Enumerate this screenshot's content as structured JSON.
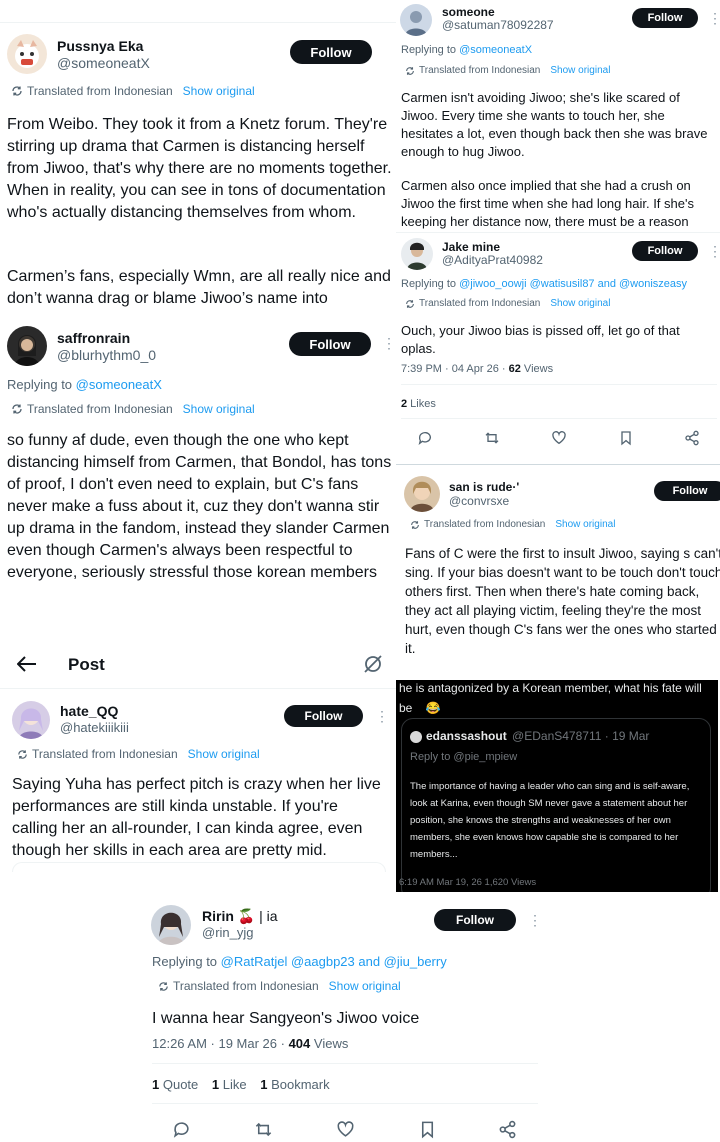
{
  "panel1": {
    "author": "Pussnya Eka",
    "handle": "@someoneatX",
    "follow": "Follow",
    "translated": "Translated from Indonesian",
    "show_original": "Show original",
    "text_p1": "From Weibo. They took it from a Knetz forum. They're stirring up drama that Carmen is distancing herself from Jiwoo, that's why there are no moments together. When in reality, you can see in tons of documentation who's actually distancing themselves from whom.",
    "text_p2": "Carmen’s fans, especially Wmn, are all really nice and don’t wanna drag or blame Jiwoo’s name into"
  },
  "panel2": {
    "author": "saffronrain",
    "handle": "@blurhythm0_0",
    "follow": "Follow",
    "replying_prefix": "Replying to",
    "replying_to": "@someoneatX",
    "translated": "Translated from Indonesian",
    "show_original": "Show original",
    "text": "so funny af dude, even though the one who kept distancing himself from Carmen, that Bondol, has tons of proof, I don't even need to explain, but C's fans never make a fuss about it, cuz they don't wanna stir up drama in the fandom, instead they slander Carmen even though Carmen's always been respectful to everyone, seriously stressful those korean members"
  },
  "panel3": {
    "author": "someone",
    "handle": "@satuman78092287",
    "follow": "Follow",
    "replying_prefix": "Replying to",
    "replying_to": "@someoneatX",
    "translated": "Translated from Indonesian",
    "show_original": "Show original",
    "text_p1": "Carmen isn't avoiding Jiwoo; she's like scared of Jiwoo. Every time she wants to touch her, she hesitates a lot, even though back then she was brave enough to hug Jiwoo.",
    "text_p2": "Carmen also once implied that she had a crush on Jiwoo the first time when she had long hair. If she's keeping her distance now, there must be a reason"
  },
  "panel4": {
    "author": "Jake mine",
    "handle": "@AdityaPrat40982",
    "follow": "Follow",
    "replying_prefix": "Replying to",
    "replying_to": "@jiwoo_oowji @watisusil87 and @woniszeasy",
    "translated": "Translated from Indonesian",
    "show_original": "Show original",
    "text": "Ouch, your Jiwoo bias is pissed off, let go of that oplas.",
    "time": "7:39 PM · 04 Apr 26 · ",
    "views_count": "62",
    "views_label": " Views",
    "likes_count": "2",
    "likes_label": " Likes"
  },
  "panel5": {
    "author": "san is rude",
    "author_suffix": "·'",
    "handle": "@convrsxe",
    "follow": "Follow",
    "translated": "Translated from Indonesian",
    "show_original": "Show original",
    "text": "Fans of C were the first to insult Jiwoo, saying s can't sing. If your bias doesn't want to be touch don't touch others first. Then when there's hate coming back, they act all playing victim, feeling they're the most hurt, even though C's fans wer the ones who started it."
  },
  "panel6": {
    "header_text": "he is antagonized by a Korean member, what his fate will be",
    "emoji": "😂",
    "quote_author": "edanssashout",
    "quote_handle_date": "@EDanS478711 · 19 Mar",
    "quote_reply": "Reply to @pie_mpiew",
    "quote_text": "The importance of having a leader who can sing and is self-aware, look at Karina, even though SM never gave a statement about her position, she knows the strengths and weaknesses of her own members, she even knows how capable she is compared to her members...",
    "footer": "6:19 AM Mar 19, 26 1,620 Views"
  },
  "panel7": {
    "nav_title": "Post",
    "author": "hate_QQ",
    "handle": "@hatekiiikiii",
    "follow": "Follow",
    "translated": "Translated from Indonesian",
    "show_original": "Show original",
    "text": "Saying Yuha has perfect pitch is crazy when her live performances are still kinda unstable. If you're calling her an all-rounder, I can kinda agree, even though her skills in each area are pretty mid."
  },
  "panel8": {
    "author": "Ririn",
    "author_emoji": "🍒",
    "author_suffix": " | ia",
    "handle": "@rin_yjg",
    "follow": "Follow",
    "replying_prefix": "Replying to",
    "replying_to": "@RatRatjel @aagbp23 and @jiu_berry",
    "translated": "Translated from Indonesian",
    "show_original": "Show original",
    "text": "I wanna hear Sangyeon's Jiwoo voice",
    "time": "12:26 AM · 19 Mar 26 · ",
    "views_count": "404",
    "views_label": " Views",
    "quote_count": "1",
    "quote_label": " Quote",
    "like_count": "1",
    "like_label": " Like",
    "bookmark_count": "1",
    "bookmark_label": " Bookmark"
  },
  "icons": [
    "translate-icon",
    "reply-icon",
    "retweet-icon",
    "like-icon",
    "bookmark-icon",
    "share-icon",
    "back-arrow-icon",
    "grok-icon",
    "more-icon"
  ],
  "colors": {
    "accent": "#1d9bf0",
    "text": "#0f1419",
    "muted": "#536471",
    "button": "#0f1419",
    "dark_bg": "#000000"
  }
}
